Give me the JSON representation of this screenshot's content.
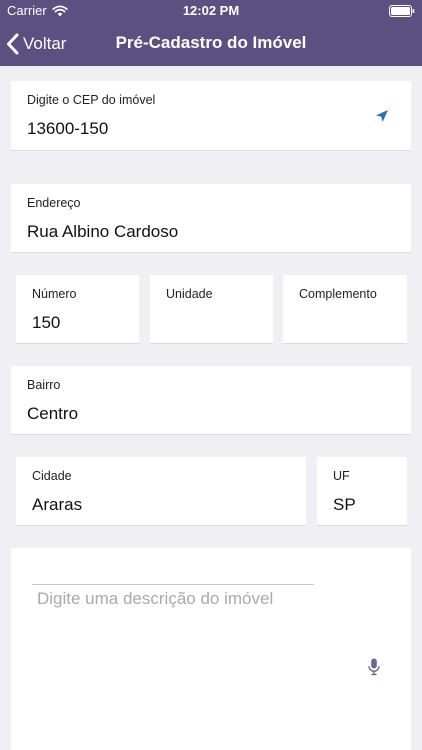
{
  "status_bar": {
    "carrier": "Carrier",
    "time": "12:02 PM"
  },
  "nav": {
    "back_label": "Voltar",
    "title": "Pré-Cadastro do Imóvel"
  },
  "form": {
    "cep": {
      "label": "Digite o CEP do imóvel",
      "value": "13600-150"
    },
    "endereco": {
      "label": "Endereço",
      "value": "Rua Albino Cardoso"
    },
    "numero": {
      "label": "Número",
      "value": "150"
    },
    "unidade": {
      "label": "Unidade",
      "value": ""
    },
    "complemento": {
      "label": "Complemento",
      "value": ""
    },
    "bairro": {
      "label": "Bairro",
      "value": "Centro"
    },
    "cidade": {
      "label": "Cidade",
      "value": "Araras"
    },
    "uf": {
      "label": "UF",
      "value": "SP"
    },
    "descricao": {
      "placeholder": "Digite uma descrição do imóvel"
    }
  },
  "colors": {
    "header": "#5b5080",
    "background": "#efeff4",
    "accent": "#2a6fb0"
  },
  "icons": [
    "wifi-icon",
    "battery-icon",
    "chevron-left-icon",
    "location-arrow-icon",
    "microphone-icon"
  ]
}
